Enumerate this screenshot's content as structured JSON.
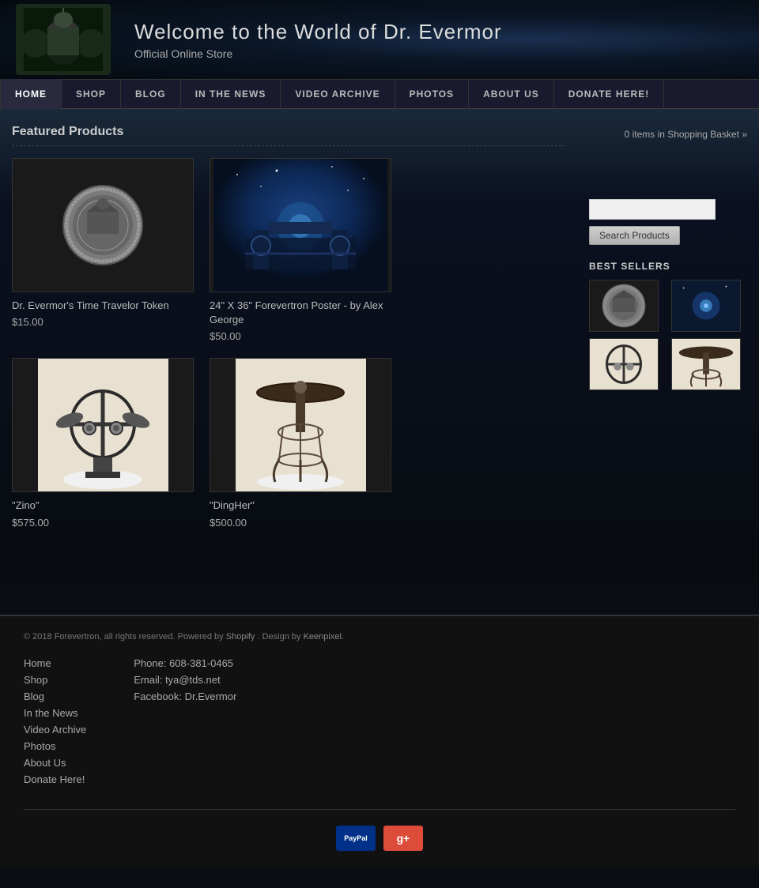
{
  "header": {
    "title": "Welcome to the World of Dr. Evermor",
    "subtitle": "Official Online Store"
  },
  "nav": {
    "items": [
      {
        "label": "HOME",
        "active": true
      },
      {
        "label": "SHOP",
        "active": false
      },
      {
        "label": "BLOG",
        "active": false
      },
      {
        "label": "IN THE NEWS",
        "active": false
      },
      {
        "label": "VIDEO ARCHIVE",
        "active": false
      },
      {
        "label": "PHOTOS",
        "active": false
      },
      {
        "label": "ABOUT US",
        "active": false
      },
      {
        "label": "DONATE HERE!",
        "active": false
      }
    ]
  },
  "page": {
    "featured_title": "Featured Products",
    "basket_text": "0 items in Shopping Basket »",
    "search_placeholder": "",
    "search_button": "Search Products",
    "best_sellers_title": "BEST SELLERS"
  },
  "products": [
    {
      "name": "Dr. Evermor's Time Travelor Token",
      "price": "$15.00",
      "type": "coin"
    },
    {
      "name": "24\" X 36\" Forevertron Poster - by Alex George",
      "price": "$50.00",
      "type": "poster"
    },
    {
      "name": "\"Zino\"",
      "price": "$575.00",
      "type": "sculpture1"
    },
    {
      "name": "\"DingHer\"",
      "price": "$500.00",
      "type": "sculpture2"
    }
  ],
  "footer": {
    "copyright": "© 2018 Forevertron, all rights reserved. Powered by",
    "powered_by": "Shopify",
    "design_by_text": ". Design by",
    "designer": "Keenpixel",
    "nav_links": [
      "Home",
      "Shop",
      "Blog",
      "In the News",
      "Video Archive",
      "Photos",
      "About Us",
      "Donate Here!"
    ],
    "phone": "Phone: 608-381-0465",
    "email": "Email: tya@tds.net",
    "facebook": "Facebook: Dr.Evermor"
  }
}
